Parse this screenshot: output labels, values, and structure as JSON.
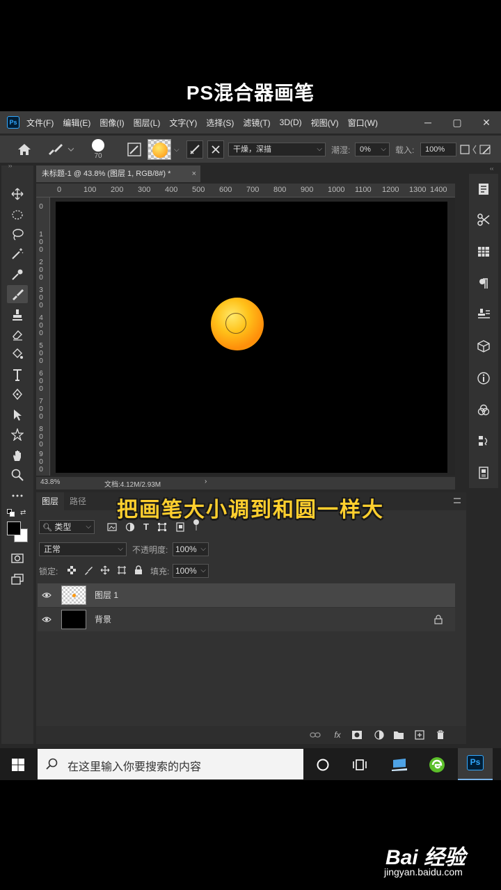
{
  "banner": {
    "title": "PS混合器画笔"
  },
  "app": {
    "logo": "Ps",
    "menu": [
      "文件(F)",
      "编辑(E)",
      "图像(I)",
      "图层(L)",
      "文字(Y)",
      "选择(S)",
      "滤镜(T)",
      "3D(D)",
      "视图(V)",
      "窗口(W)"
    ],
    "window_controls": [
      "─",
      "▢",
      "✕"
    ]
  },
  "options": {
    "brush_size": "70",
    "mix_preset": "干燥，深描",
    "wet_label": "潮湿:",
    "wet_value": "0%",
    "load_label": "载入:",
    "load_value": "100%"
  },
  "document": {
    "tab_title": "未标题-1 @ 43.8% (图层 1, RGB/8#) *",
    "close": "×",
    "ruler_top": [
      "0",
      "100",
      "200",
      "300",
      "400",
      "500",
      "600",
      "700",
      "800",
      "900",
      "1000",
      "1100",
      "1200",
      "1300",
      "1400"
    ],
    "ruler_left": [
      "0",
      "1\n0\n0",
      "2\n0\n0",
      "3\n0\n0",
      "4\n0\n0",
      "5\n0\n0",
      "6\n0\n0",
      "7\n0\n0",
      "8\n0\n0",
      "9\n0\n0"
    ],
    "zoom": "43.8%",
    "doc_info": "文档:4.12M/2.93M",
    "arrow": "›"
  },
  "subtitle": "把画笔大小调到和圆一样大",
  "layers_panel": {
    "tabs": [
      "图层",
      "路径"
    ],
    "filter_label": "类型",
    "blend_mode": "正常",
    "opacity_label": "不透明度:",
    "opacity_value": "100%",
    "lock_label": "锁定:",
    "fill_label": "填充:",
    "fill_value": "100%",
    "layers": [
      {
        "name": "图层 1",
        "selected": true
      },
      {
        "name": "背景",
        "locked": true
      }
    ],
    "footer_fx": "fx"
  },
  "taskbar": {
    "search_placeholder": "在这里输入你要搜索的内容",
    "ps_label": "Ps"
  },
  "watermark": {
    "logo": "Bai 经验",
    "url": "jingyan.baidu.com"
  },
  "colors": {
    "accent": "#31a8ff",
    "subtitle": "#ffcf2e",
    "ball_inner": "#ffe96a",
    "ball_outer": "#ff8e0a"
  }
}
